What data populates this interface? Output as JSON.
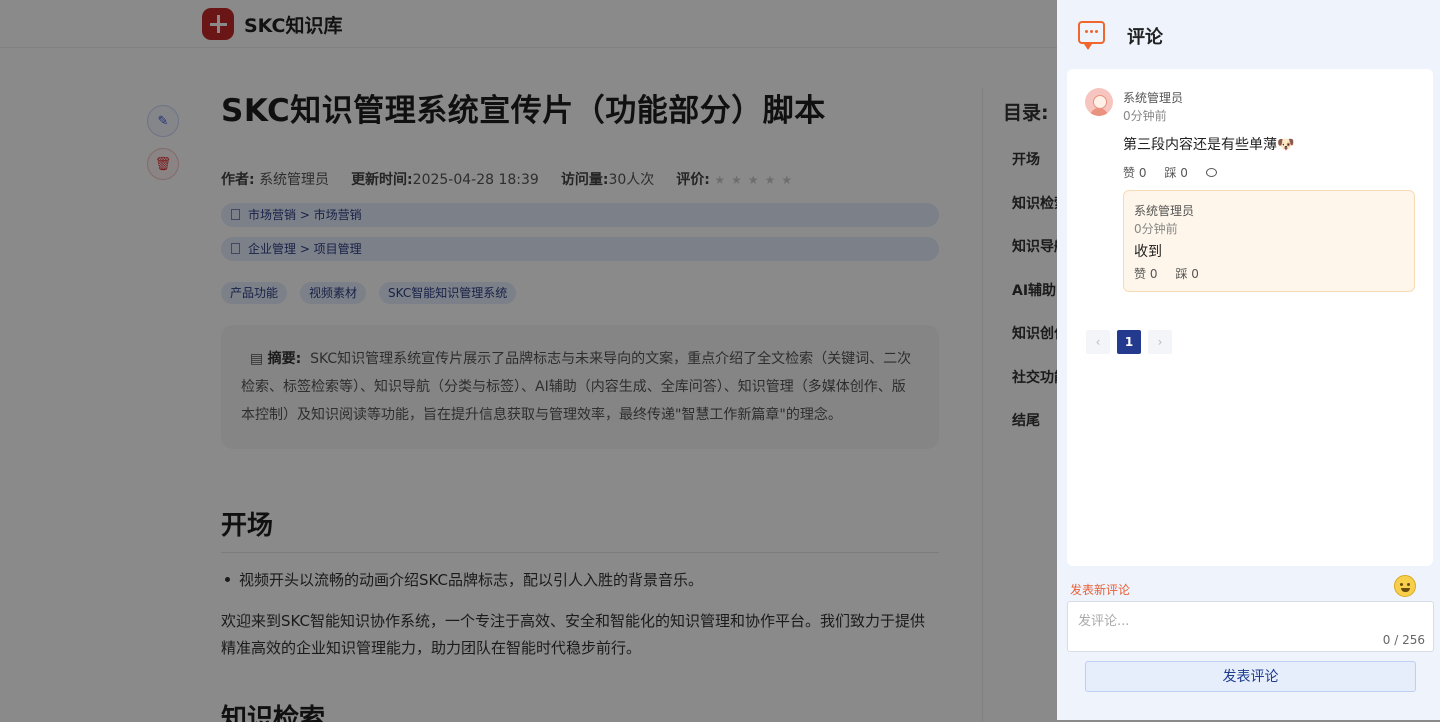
{
  "site": {
    "name": "SKC知识库"
  },
  "article": {
    "title": "SKC知识管理系统宣传片（功能部分）脚本",
    "meta": {
      "author_label": "作者:",
      "author": "系统管理员",
      "updated_label": "更新时间:",
      "updated": "2025-04-28 18:39",
      "views_label": "访问量:",
      "views": "30人次",
      "rating_label": "评价:",
      "rating": 0
    },
    "categories": [
      "市场营销 > 市场营销",
      "企业管理 > 项目管理"
    ],
    "tags": [
      "产品功能",
      "视频素材",
      "SKC智能知识管理系统"
    ],
    "abstract_label": "摘要:",
    "abstract": "SKC知识管理系统宣传片展示了品牌标志与未来导向的文案，重点介绍了全文检索（关键词、二次检索、标签检索等）、知识导航（分类与标签）、AI辅助（内容生成、全库问答）、知识管理（多媒体创作、版本控制）及知识阅读等功能，旨在提升信息获取与管理效率，最终传递\"智慧工作新篇章\"的理念。",
    "section1_heading": "开场",
    "section1_bullet": "视频开头以流畅的动画介绍SKC品牌标志，配以引人入胜的背景音乐。",
    "section1_para": "欢迎来到SKC智能知识协作系统，一个专注于高效、安全和智能化的知识管理和协作平台。我们致力于提供精准高效的企业知识管理能力，助力团队在智能时代稳步前行。",
    "section2_heading": "知识检索"
  },
  "toc": {
    "title": "目录:",
    "items": [
      "开场",
      "知识检索",
      "知识导航",
      "AI辅助",
      "知识创作",
      "社交功能",
      "结尾"
    ]
  },
  "comments": {
    "panel_title": "评论",
    "items": [
      {
        "author": "系统管理员",
        "time": "0分钟前",
        "text": "第三段内容还是有些单薄🐶",
        "likes": "赞 0",
        "dislikes": "踩 0",
        "reply": {
          "author": "系统管理员",
          "time": "0分钟前",
          "text": "收到",
          "likes": "赞 0",
          "dislikes": "踩 0"
        }
      }
    ],
    "pagination": {
      "prev": "‹",
      "current": "1",
      "next": "›"
    },
    "new_comment_label": "发表新评论",
    "input_placeholder": "发评论...",
    "char_count": "0 / 256",
    "submit_label": "发表评论"
  },
  "colors": {
    "accent": "#243a8f",
    "comment_icon": "#f0662c",
    "reply_bg": "#fef6ea",
    "drawer_bg": "#eef3fc"
  },
  "icons": [
    "logo-icon",
    "edit-icon",
    "delete-icon",
    "comment-icon",
    "reply-icon",
    "emoji-icon",
    "note-icon"
  ]
}
